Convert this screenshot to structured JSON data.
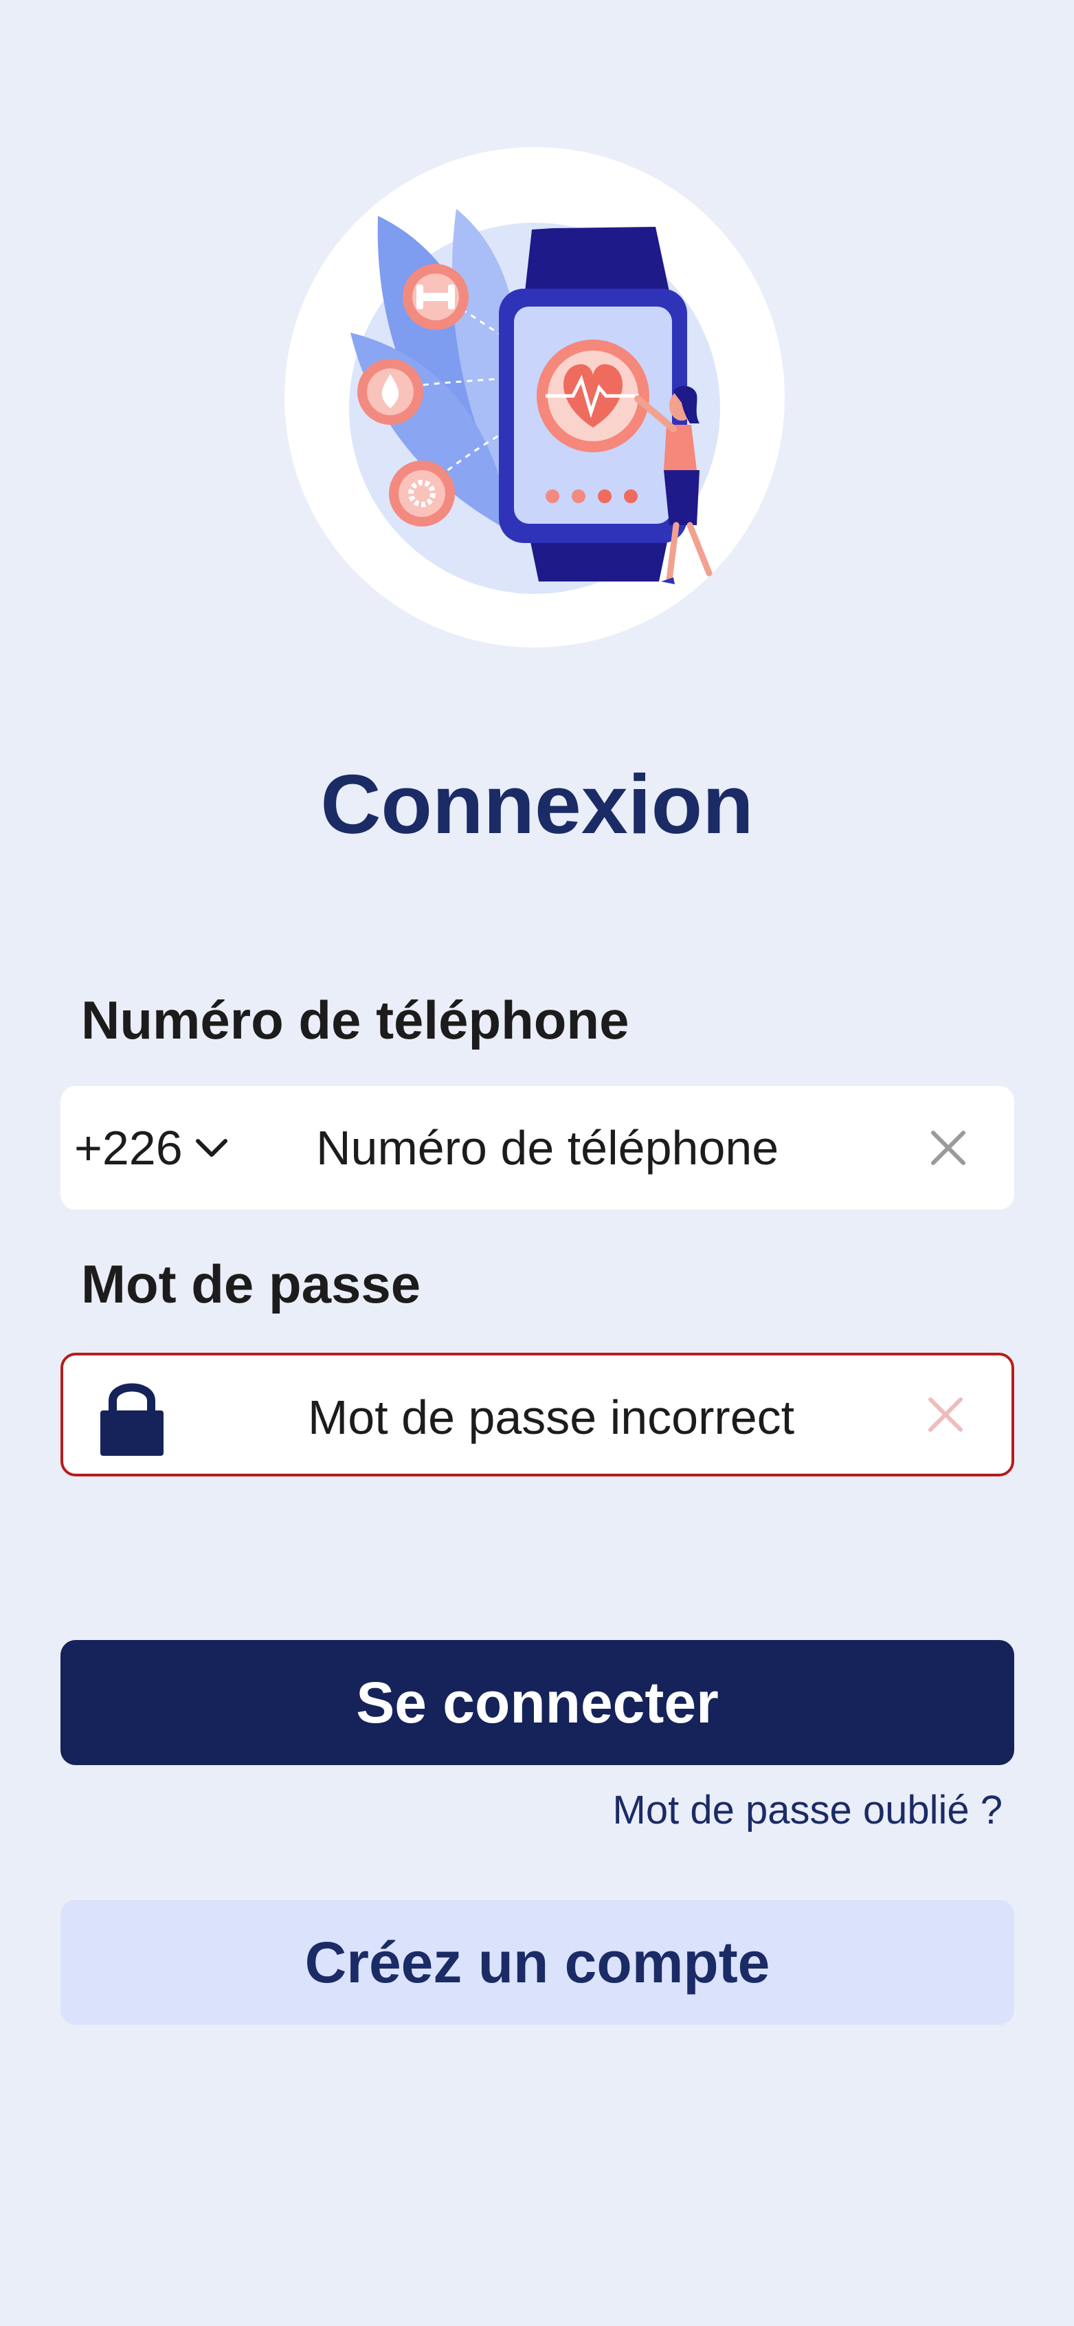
{
  "illustration": {
    "description_icon": "smartwatch-health-illustration"
  },
  "page": {
    "title": "Connexion"
  },
  "phone": {
    "label": "Numéro de téléphone",
    "country_code": "+226",
    "placeholder": "Numéro de téléphone"
  },
  "password": {
    "label": "Mot de passe",
    "value": "Mot de passe incorrect",
    "error": true
  },
  "actions": {
    "login": "Se connecter",
    "forgot": "Mot de passe oublié ?",
    "create_account": "Créez un compte"
  },
  "colors": {
    "background": "#eaeef8",
    "primary": "#15235a",
    "title": "#1b2b66",
    "error_border": "#b71c1c",
    "secondary_bg": "#dbe3fc"
  }
}
